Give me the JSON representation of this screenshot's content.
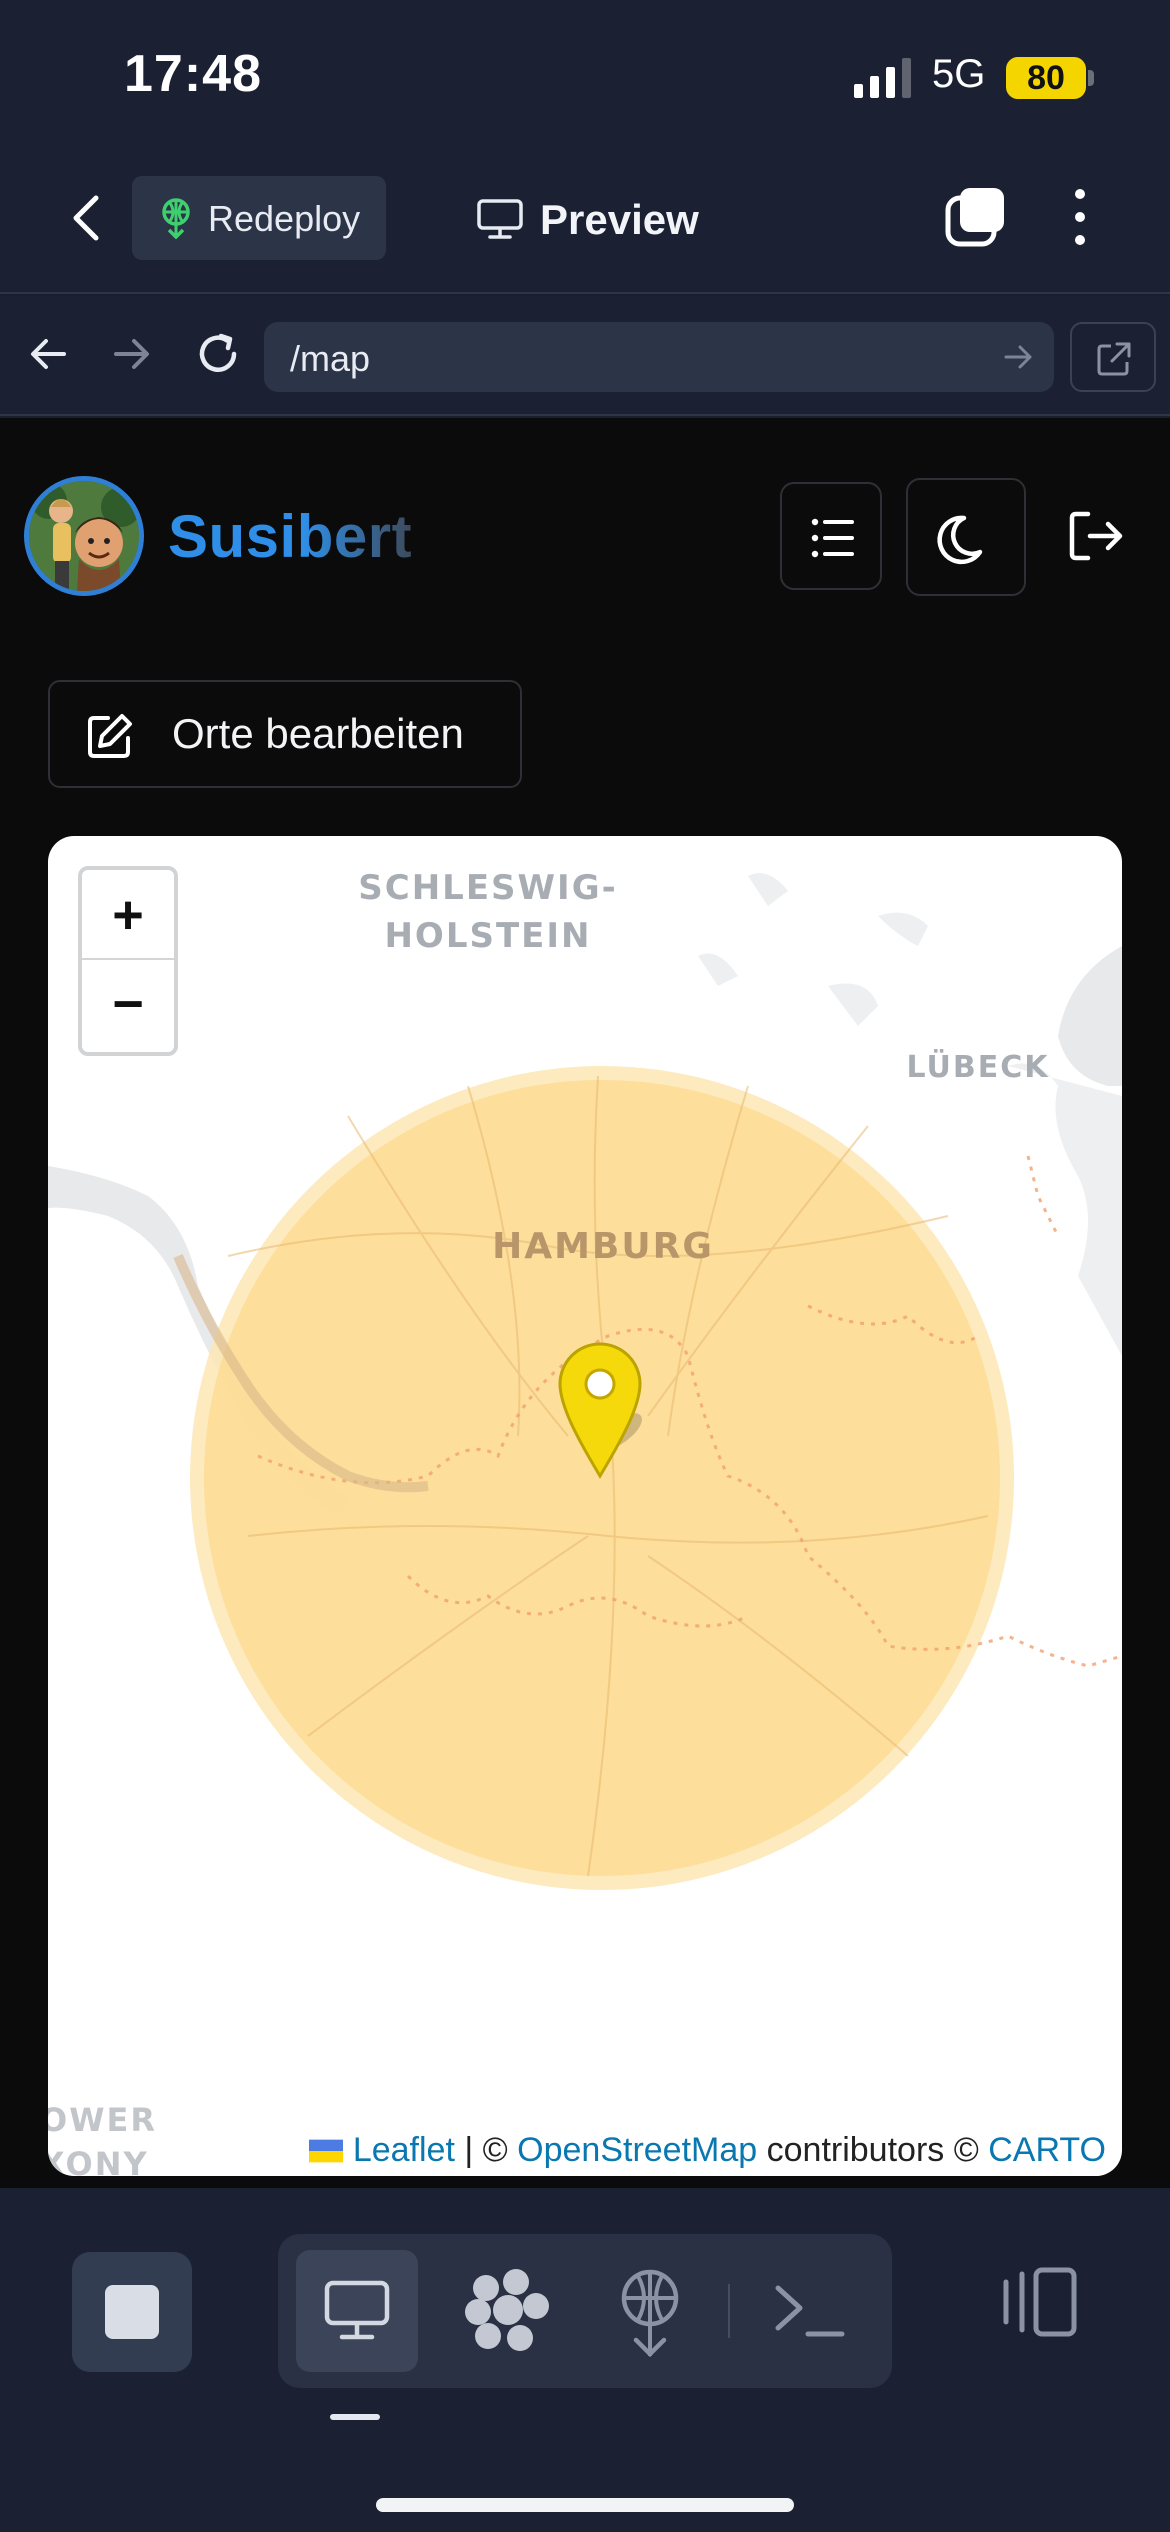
{
  "status_bar": {
    "time": "17:48",
    "network": "5G",
    "battery": "80"
  },
  "top_bar": {
    "redeploy_label": "Redeploy",
    "preview_label": "Preview"
  },
  "url_bar": {
    "path": "/map"
  },
  "app": {
    "brand": "Susibert",
    "edit_places_label": "Orte bearbeiten"
  },
  "map": {
    "labels": {
      "schleswig_1": "SCHLESWIG-",
      "schleswig_2": "HOLSTEIN",
      "luebeck": "LÜBECK",
      "hamburg": "HAMBURG",
      "lower_1": "OWER",
      "lower_2": "XONY"
    },
    "zoom_in": "+",
    "zoom_out": "−",
    "attribution": {
      "leaflet": "Leaflet",
      "sep1": " | © ",
      "osm": "OpenStreetMap",
      "contrib": " contributors © ",
      "carto": "CARTO"
    },
    "circle_color": "#fcd98a",
    "marker_color": "#f5d90a"
  },
  "colors": {
    "chrome_bg": "#1b2133",
    "accent": "#2f8fe8",
    "content_bg": "#0b0b0c"
  },
  "icons": {
    "redeploy": "redeploy-icon",
    "preview": "monitor-icon",
    "tabs": "tabs-icon",
    "more": "kebab-icon"
  }
}
